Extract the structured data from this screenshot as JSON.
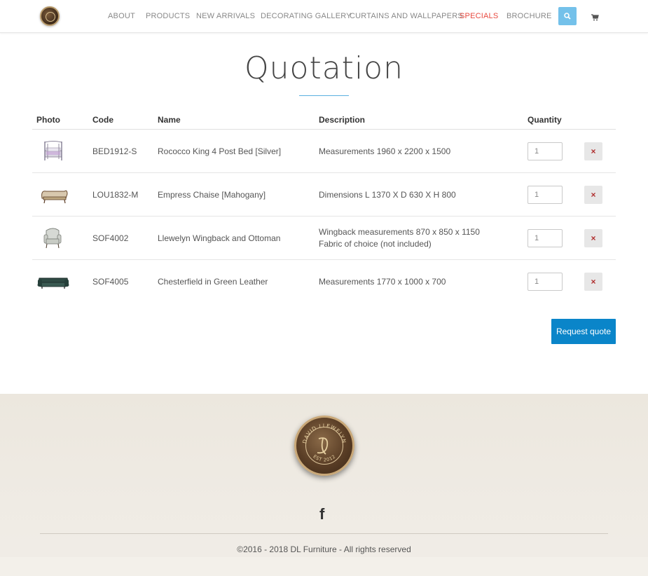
{
  "header": {
    "nav": [
      "ABOUT",
      "PRODUCTS",
      "NEW ARRIVALS",
      "DECORATING GALLERY",
      "CURTAINS AND WALLPAPERS",
      "SPECIALS",
      "BROCHURE"
    ],
    "search_icon": "search-icon",
    "cart_icon": "cart-icon",
    "accent_color": "#74c1ea",
    "specials_color": "#e8493f"
  },
  "page": {
    "title": "Quotation"
  },
  "table": {
    "columns": [
      "Photo",
      "Code",
      "Name",
      "Description",
      "Quantity"
    ],
    "rows": [
      {
        "code": "BED1912-S",
        "name": "Rococco King 4 Post Bed [Silver]",
        "description": "Measurements 1960 x 2200 x 1500",
        "description2": "",
        "quantity": "1"
      },
      {
        "code": "LOU1832-M",
        "name": "Empress Chaise [Mahogany]",
        "description": "Dimensions L 1370 X D 630 X H 800",
        "description2": "",
        "quantity": "1"
      },
      {
        "code": "SOF4002",
        "name": "Llewelyn Wingback and Ottoman",
        "description": "Wingback measurements 870 x 850 x 1150",
        "description2": "Fabric of choice (not included)",
        "quantity": "1"
      },
      {
        "code": "SOF4005",
        "name": "Chesterfield in Green Leather",
        "description": "Measurements 1770 x 1000 x 700",
        "description2": "",
        "quantity": "1"
      }
    ],
    "remove_icon": "×"
  },
  "actions": {
    "request_label": "Request quote",
    "button_color": "#0a85c9"
  },
  "footer": {
    "seal_text": "DAVID LLEWELYN",
    "seal_est": "EST 2012",
    "facebook": "f",
    "copyright": "©2016 - 2018 DL Furniture - All rights reserved"
  }
}
